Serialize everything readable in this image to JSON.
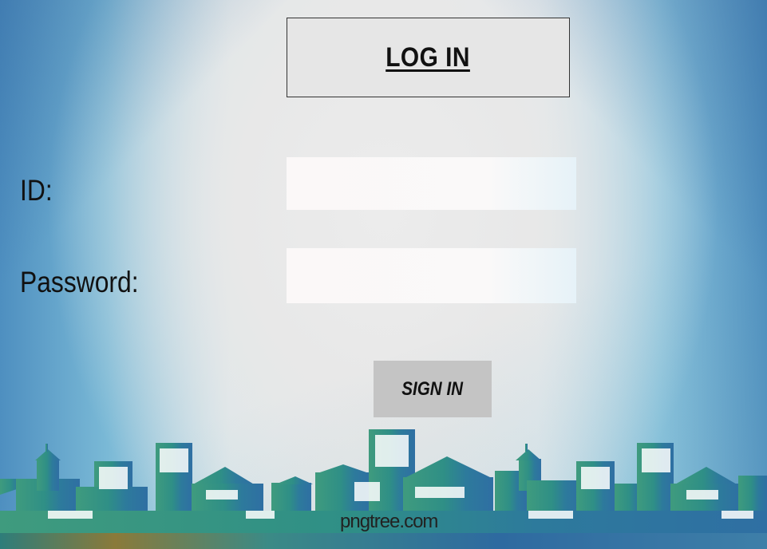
{
  "title": "LOG IN",
  "form": {
    "id_label": "ID:",
    "id_value": "",
    "password_label": "Password:",
    "password_value": "",
    "submit_label": "SIGN IN"
  },
  "background": {
    "watermark": "pngtree.com",
    "sky_edge_color": "#4e8fc0",
    "center_color": "#e9e9e9",
    "skyline_color_left": "#3a9a7f",
    "skyline_color_right": "#2f6fa3"
  }
}
